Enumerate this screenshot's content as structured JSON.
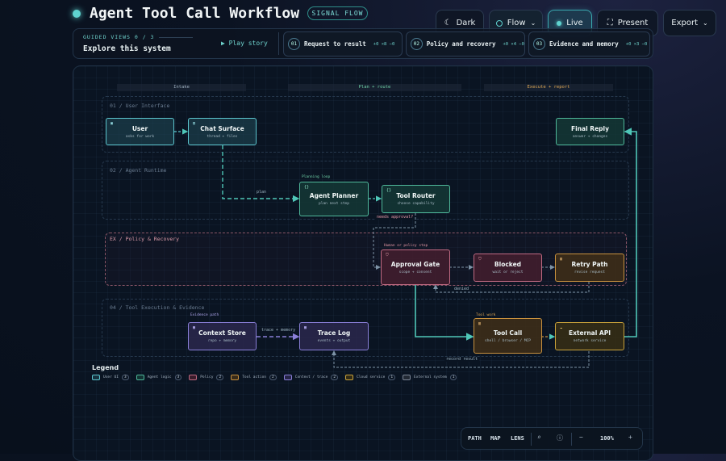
{
  "header": {
    "title": "Agent Tool Call Workflow",
    "badge": "SIGNAL FLOW"
  },
  "toolbar": {
    "theme_label": "Dark",
    "flow_label": "Flow",
    "live_label": "Live",
    "present_label": "Present",
    "export_label": "Export"
  },
  "guided": {
    "label": "GUIDED VIEWS 0 / 3",
    "title": "Explore this system",
    "play_label": "▶ Play story",
    "steps": [
      {
        "num": "01",
        "label": "Request to result",
        "counts": "+0 ×8 −0"
      },
      {
        "num": "02",
        "label": "Policy and recovery",
        "counts": "+0 ×4 −0"
      },
      {
        "num": "03",
        "label": "Evidence and memory",
        "counts": "+0 ×3 −0"
      }
    ]
  },
  "columns": [
    "Intake",
    "Plan + route",
    "Execute + report"
  ],
  "lanes": [
    "01 / User Interface",
    "02 / Agent Runtime",
    "EX / Policy & Recovery",
    "04 / Tool Execution & Evidence"
  ],
  "nodes": {
    "user": {
      "title": "User",
      "sub": "asks for work"
    },
    "chat": {
      "title": "Chat Surface",
      "sub": "thread + files"
    },
    "reply": {
      "title": "Final Reply",
      "sub": "answer + changes"
    },
    "planner": {
      "title": "Agent Planner",
      "sub": "plan next step"
    },
    "router": {
      "title": "Tool Router",
      "sub": "choose capability"
    },
    "gate": {
      "title": "Approval Gate",
      "sub": "scope + consent"
    },
    "blocked": {
      "title": "Blocked",
      "sub": "wait or reject"
    },
    "retry": {
      "title": "Retry Path",
      "sub": "revise request"
    },
    "context": {
      "title": "Context Store",
      "sub": "repo + memory"
    },
    "trace": {
      "title": "Trace Log",
      "sub": "events + output"
    },
    "toolcall": {
      "title": "Tool Call",
      "sub": "shell / browser / MCP"
    },
    "api": {
      "title": "External API",
      "sub": "network service"
    }
  },
  "tags": {
    "planning_loop": "Planning loop",
    "human_policy": "Human or policy stop",
    "evidence_path": "Evidence path",
    "tool_work": "Tool work"
  },
  "edges": {
    "plan": "plan",
    "needs_approval": "needs approval?",
    "denied": "denied",
    "trace_memory": "trace + memory",
    "record_result": "record result"
  },
  "legend": {
    "title": "Legend",
    "items": [
      {
        "label": "User UI",
        "count": "3",
        "color": "#5cc6cf"
      },
      {
        "label": "Agent logic",
        "count": "3",
        "color": "#4fb89a"
      },
      {
        "label": "Policy",
        "count": "2",
        "color": "#c06a82"
      },
      {
        "label": "Tool action",
        "count": "2",
        "color": "#c8913e"
      },
      {
        "label": "Context / trace",
        "count": "2",
        "color": "#8a7fd8"
      },
      {
        "label": "Cloud service",
        "count": "1",
        "color": "#c9a23a"
      },
      {
        "label": "External system",
        "count": "1",
        "color": "#7c8798"
      }
    ]
  },
  "zoom": {
    "path": "PATH",
    "map": "MAP",
    "lens": "LENS",
    "level": "100%",
    "minus": "−",
    "plus": "+"
  }
}
